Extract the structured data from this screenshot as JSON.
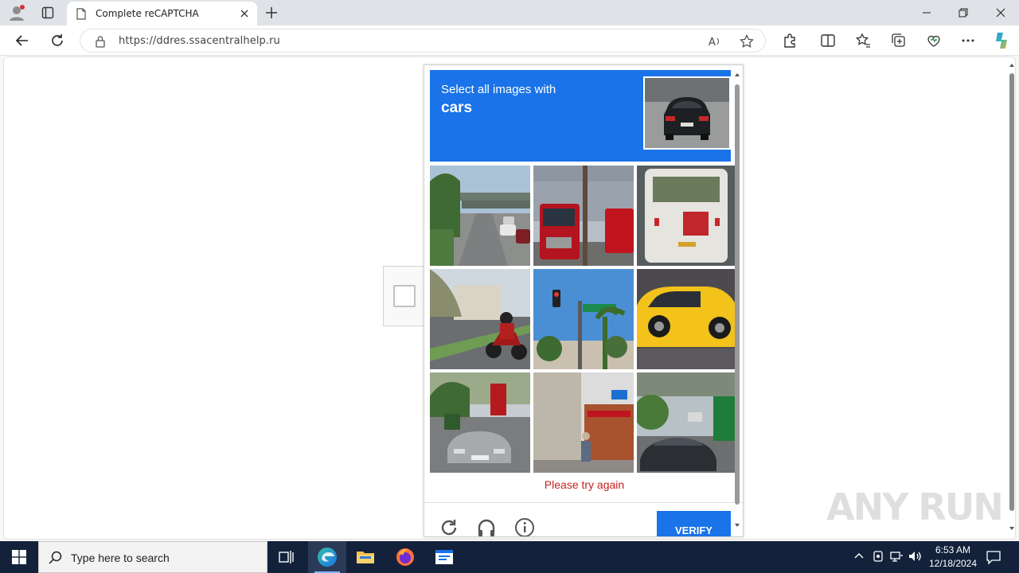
{
  "browser": {
    "tab_title": "Complete reCAPTCHA",
    "url": "https://ddres.ssacentralhelp.ru"
  },
  "captcha": {
    "instruction": "Select all images with",
    "target": "cars",
    "error": "Please try again",
    "verify_label": "VERIFY",
    "tiles": [
      "Overpass road with cars",
      "Red truck",
      "Bus rear",
      "Motorcycle on street",
      "Traffic light and palm trees",
      "Yellow taxi",
      "Silver car on street",
      "Street storefront",
      "Dark car on street"
    ]
  },
  "taskbar": {
    "search_placeholder": "Type here to search",
    "time": "6:53 AM",
    "date": "12/18/2024"
  },
  "watermark": "ANY RUN",
  "colors": {
    "accent": "#1a73e8",
    "error": "#c5221f",
    "taskbar": "#14213b"
  }
}
